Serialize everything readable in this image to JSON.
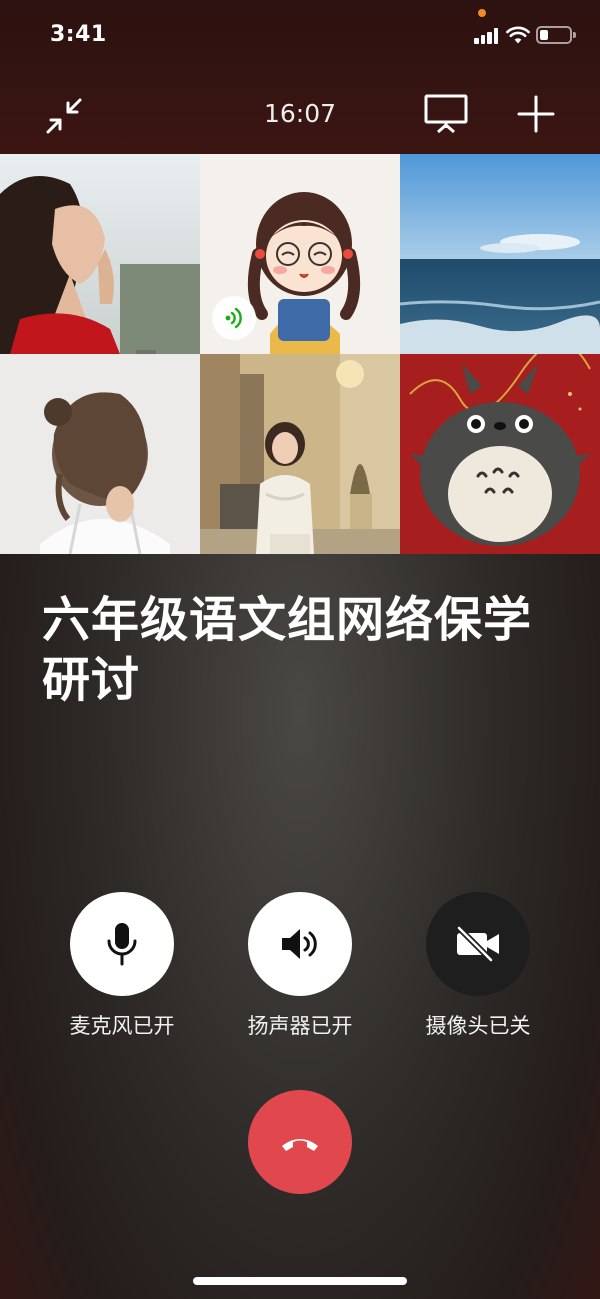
{
  "status_bar": {
    "time": "3:41"
  },
  "toolbar": {
    "call_duration": "16:07"
  },
  "participants": [
    {
      "tile": "participant-1",
      "speaking": false
    },
    {
      "tile": "participant-2",
      "speaking": true
    },
    {
      "tile": "participant-3",
      "speaking": false
    },
    {
      "tile": "participant-4",
      "speaking": false
    },
    {
      "tile": "participant-5",
      "speaking": false
    },
    {
      "tile": "participant-6",
      "speaking": false
    }
  ],
  "meeting": {
    "title": "六年级语文组网络保学研讨"
  },
  "controls": {
    "mic_label": "麦克风已开",
    "speaker_label": "扬声器已开",
    "camera_label": "摄像头已关"
  },
  "icons": {
    "minimize": "minimize-icon",
    "screen_share": "screen-share-icon",
    "add": "add-participant-icon",
    "mic": "microphone-icon",
    "speaker": "speaker-icon",
    "camera": "camera-off-icon",
    "hangup": "hang-up-icon"
  },
  "colors": {
    "hangup": "#e0484d",
    "control_on": "#ffffff",
    "control_off": "#1e1e1e",
    "speaking_indicator": "#1aad19"
  }
}
